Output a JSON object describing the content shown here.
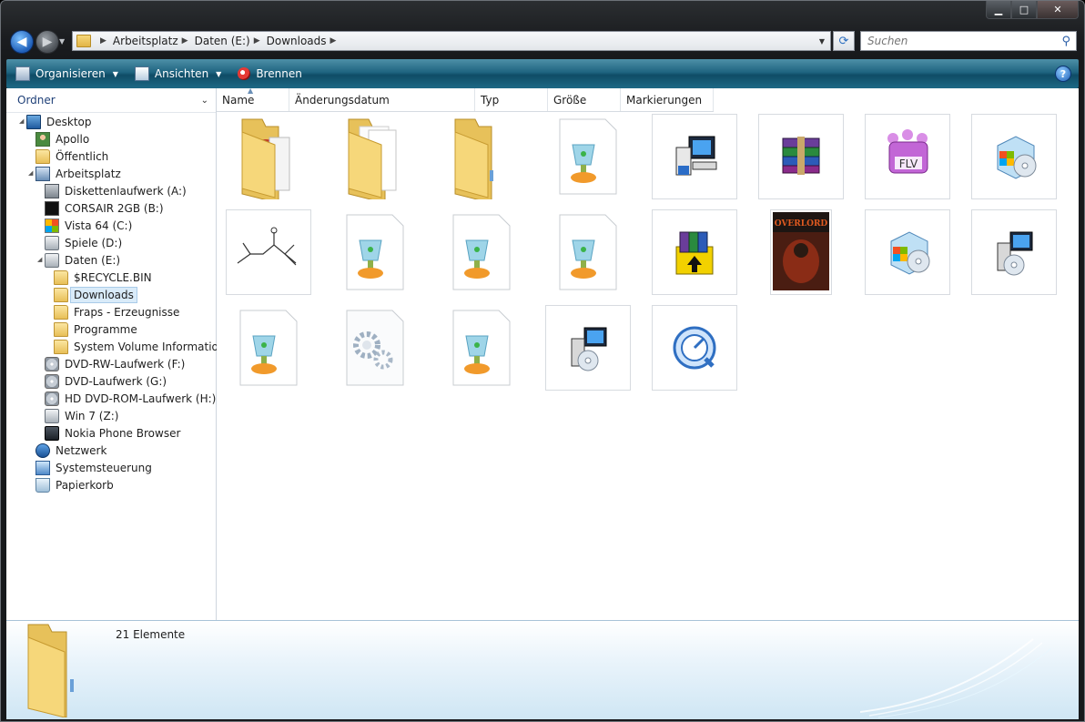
{
  "address": {
    "crumbs": [
      "Arbeitsplatz",
      "Daten (E:)",
      "Downloads"
    ]
  },
  "search": {
    "placeholder": "Suchen"
  },
  "toolbar": {
    "organize_label": "Organisieren",
    "views_label": "Ansichten",
    "burn_label": "Brennen",
    "help_label": "?"
  },
  "navpane": {
    "header": "Ordner",
    "items": [
      {
        "label": "Desktop",
        "icon": "desktop-icon"
      },
      {
        "label": "Apollo",
        "icon": "user-folder-icon"
      },
      {
        "label": "Öffentlich",
        "icon": "folder-icon"
      },
      {
        "label": "Arbeitsplatz",
        "icon": "computer-icon"
      },
      {
        "label": "Diskettenlaufwerk (A:)",
        "icon": "floppy-drive-icon"
      },
      {
        "label": "CORSAIR 2GB (B:)",
        "icon": "usb-drive-icon"
      },
      {
        "label": "Vista 64 (C:)",
        "icon": "windows-drive-icon"
      },
      {
        "label": "Spiele (D:)",
        "icon": "hard-drive-icon"
      },
      {
        "label": "Daten (E:)",
        "icon": "hard-drive-icon"
      },
      {
        "label": "$RECYCLE.BIN",
        "icon": "folder-icon"
      },
      {
        "label": "Downloads",
        "icon": "folder-icon"
      },
      {
        "label": "Fraps - Erzeugnisse",
        "icon": "folder-icon"
      },
      {
        "label": "Programme",
        "icon": "folder-icon"
      },
      {
        "label": "System Volume Information",
        "icon": "folder-icon"
      },
      {
        "label": "DVD-RW-Laufwerk (F:)",
        "icon": "dvd-drive-icon"
      },
      {
        "label": "DVD-Laufwerk (G:)",
        "icon": "dvd-drive-icon"
      },
      {
        "label": "HD DVD-ROM-Laufwerk (H:)",
        "icon": "dvd-drive-icon"
      },
      {
        "label": "Win 7 (Z:)",
        "icon": "network-drive-icon"
      },
      {
        "label": "Nokia Phone Browser",
        "icon": "phone-icon"
      },
      {
        "label": "Netzwerk",
        "icon": "network-icon"
      },
      {
        "label": "Systemsteuerung",
        "icon": "control-panel-icon"
      },
      {
        "label": "Papierkorb",
        "icon": "recycle-bin-icon"
      }
    ],
    "selected": "Downloads"
  },
  "columns": [
    "Name",
    "Änderungsdatum",
    "Typ",
    "Größe",
    "Markierungen"
  ],
  "files": [
    {
      "icon": "folder-with-content-icon"
    },
    {
      "icon": "folder-with-documents-icon"
    },
    {
      "icon": "empty-folder-icon"
    },
    {
      "icon": "trophy-file-icon"
    },
    {
      "icon": "setup-computer-icon"
    },
    {
      "icon": "winrar-archive-icon"
    },
    {
      "icon": "flv-file-icon"
    },
    {
      "icon": "installer-box-icon"
    },
    {
      "icon": "molecule-thumbnail-icon"
    },
    {
      "icon": "trophy-file-icon"
    },
    {
      "icon": "trophy-file-icon"
    },
    {
      "icon": "trophy-file-icon"
    },
    {
      "icon": "winrar-sfx-icon"
    },
    {
      "icon": "overlord-cover-thumbnail"
    },
    {
      "icon": "installer-box-icon"
    },
    {
      "icon": "setup-disc-icon"
    },
    {
      "icon": "trophy-file-icon"
    },
    {
      "icon": "system-file-gears-icon"
    },
    {
      "icon": "trophy-file-icon"
    },
    {
      "icon": "setup-disc-icon"
    },
    {
      "icon": "quicktime-icon"
    }
  ],
  "details": {
    "count_text": "21 Elemente"
  },
  "colors": {
    "accent": "#1f6480",
    "selection": "#d9ebf9",
    "folder": "#f1cf6c"
  }
}
